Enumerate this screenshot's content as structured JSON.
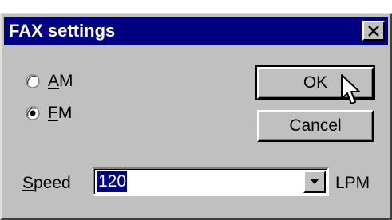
{
  "dialog": {
    "title": "FAX settings"
  },
  "modulation": {
    "options": [
      {
        "label": "AM",
        "mnemonic": "A",
        "rest": "M",
        "selected": false
      },
      {
        "label": "FM",
        "mnemonic": "F",
        "rest": "M",
        "selected": true
      }
    ]
  },
  "buttons": {
    "ok_label": "OK",
    "cancel_label": "Cancel"
  },
  "speed": {
    "label_mnemonic": "S",
    "label_rest": "peed",
    "value": "120",
    "unit": "LPM"
  },
  "icons": {
    "close": "close-icon",
    "dropdown": "chevron-down-icon",
    "cursor": "mouse-pointer-icon"
  }
}
